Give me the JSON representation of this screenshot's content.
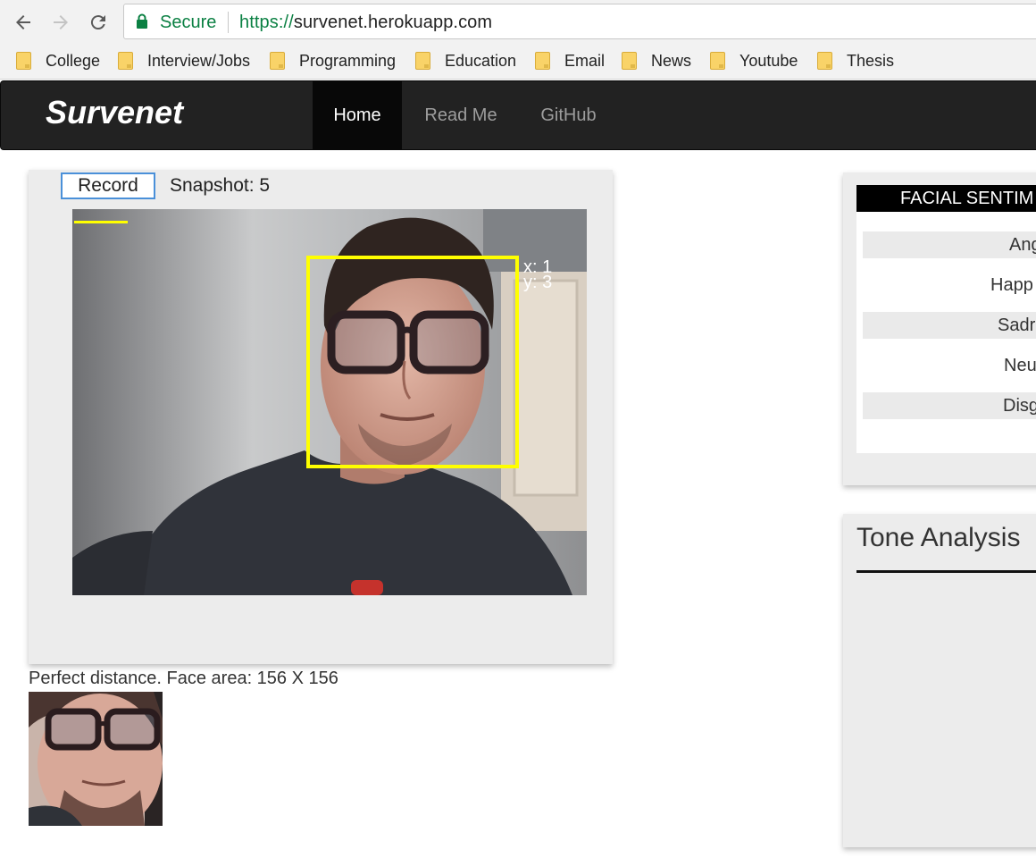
{
  "browser": {
    "secure_label": "Secure",
    "url_scheme": "https://",
    "url_host": "survenet.herokuapp.com",
    "bookmarks": [
      {
        "label": "College"
      },
      {
        "label": "Interview/Jobs"
      },
      {
        "label": "Programming"
      },
      {
        "label": "Education"
      },
      {
        "label": "Email"
      },
      {
        "label": "News"
      },
      {
        "label": "Youtube"
      },
      {
        "label": "Thesis"
      }
    ],
    "icons": {
      "back": "arrow-back-icon",
      "forward": "arrow-forward-icon",
      "reload": "reload-icon",
      "lock": "lock-icon",
      "folder": "folder-icon"
    }
  },
  "navbar": {
    "brand": "Survenet",
    "items": [
      {
        "label": "Home",
        "active": true
      },
      {
        "label": "Read Me",
        "active": false
      },
      {
        "label": "GitHub",
        "active": false
      }
    ]
  },
  "camera": {
    "record_label": "Record",
    "snapshot_text": "Snapshot: 5",
    "overlay_x": "x: 1",
    "overlay_y": "y: 3",
    "status_text": "Perfect distance. Face area: 156 X 156"
  },
  "sentiment": {
    "header": "FACIAL SENTIM",
    "rows": [
      {
        "label": "Ang"
      },
      {
        "label": "Happ"
      },
      {
        "label": "Sadr"
      },
      {
        "label": "Neu"
      },
      {
        "label": "Disg"
      }
    ]
  },
  "tone": {
    "title": "Tone Analysis"
  },
  "colors": {
    "navbar_bg": "#222222",
    "face_box": "#ffff00",
    "secure_green": "#0b8043",
    "panel_bg": "#ececec",
    "record_border": "#4a90d9"
  }
}
